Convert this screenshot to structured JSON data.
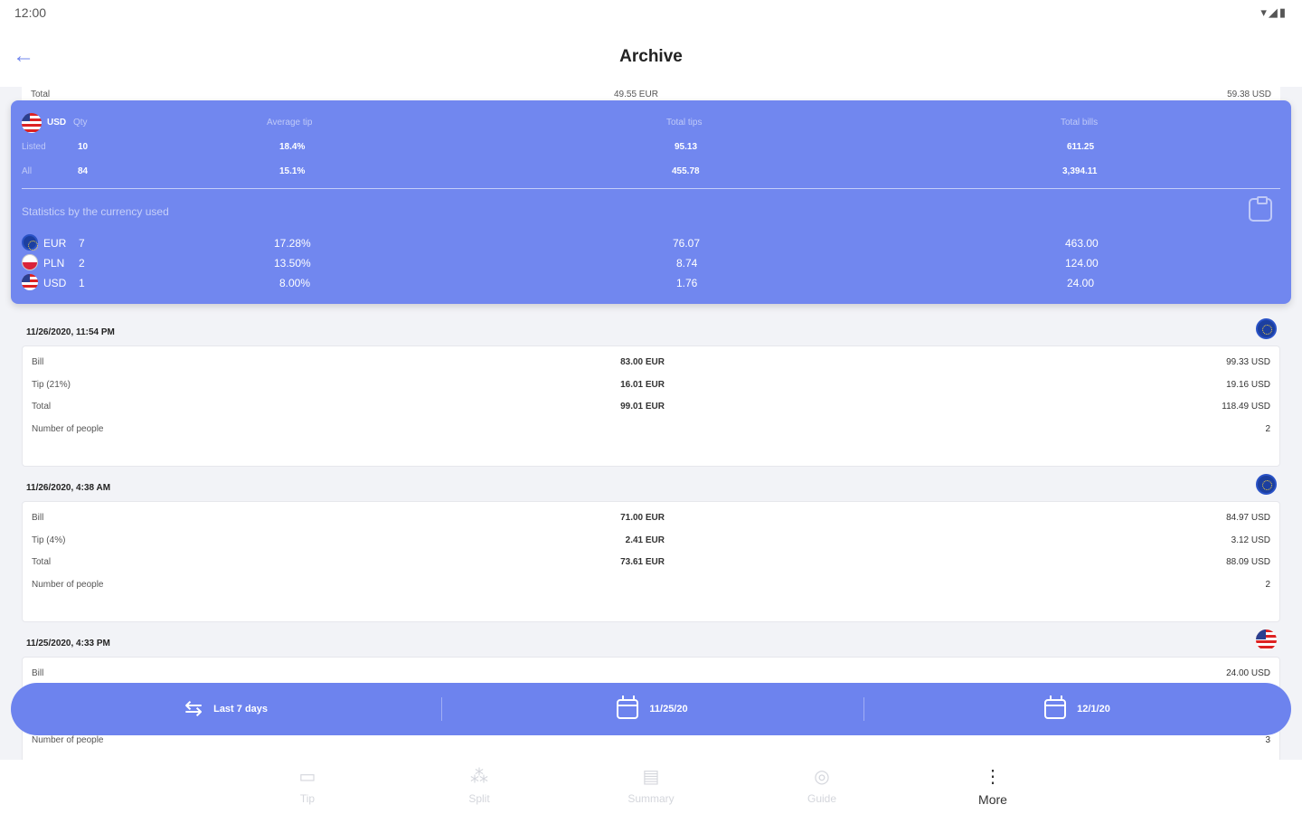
{
  "status_bar": {
    "time": "12:00",
    "icons": "▾◢▮"
  },
  "app_bar": {
    "title": "Archive",
    "back_icon": "arrow-left-icon"
  },
  "previous_entry_total": {
    "label": "Total",
    "mid": "49.55 EUR",
    "right": "59.38 USD"
  },
  "stats": {
    "header": {
      "currency": "USD",
      "qty": "Qty",
      "average_tip": "Average tip",
      "total_tips": "Total tips",
      "total_bills": "Total bills"
    },
    "rows": [
      {
        "label": "Listed",
        "qty": "10",
        "average_tip": "18.4%",
        "total_tips": "95.13",
        "total_bills": "611.25"
      },
      {
        "label": "All",
        "qty": "84",
        "average_tip": "15.1%",
        "total_tips": "455.78",
        "total_bills": "3,394.11"
      }
    ],
    "subtitle": "Statistics by the currency used",
    "by_currency": [
      {
        "currency": "EUR",
        "qty": "7",
        "average_tip": "17.28%",
        "total_tips": "76.07",
        "total_bills": "463.00",
        "flag": "eu"
      },
      {
        "currency": "PLN",
        "qty": "2",
        "average_tip": "13.50%",
        "total_tips": "8.74",
        "total_bills": "124.00",
        "flag": "pl"
      },
      {
        "currency": "USD",
        "qty": "1",
        "average_tip": "8.00%",
        "total_tips": "1.76",
        "total_bills": "24.00",
        "flag": "us"
      }
    ]
  },
  "entries": [
    {
      "date": "11/26/2020, 11:54 PM",
      "flag": "eu",
      "rows": [
        {
          "label": "Bill",
          "mid": "83.00 EUR",
          "right": "99.33 USD"
        },
        {
          "label": "Tip (21%)",
          "mid": "16.01 EUR",
          "right": "19.16 USD"
        },
        {
          "label": "Total",
          "mid": "99.01 EUR",
          "right": "118.49 USD"
        },
        {
          "label": "Number of people",
          "mid": "",
          "right": "2"
        }
      ]
    },
    {
      "date": "11/26/2020, 4:38 AM",
      "flag": "eu",
      "rows": [
        {
          "label": "Bill",
          "mid": "71.00 EUR",
          "right": "84.97 USD"
        },
        {
          "label": "Tip (4%)",
          "mid": "2.41 EUR",
          "right": "3.12 USD"
        },
        {
          "label": "Total",
          "mid": "73.61 EUR",
          "right": "88.09 USD"
        },
        {
          "label": "Number of people",
          "mid": "",
          "right": "2"
        }
      ]
    },
    {
      "date": "11/25/2020, 4:33 PM",
      "flag": "us",
      "rows": [
        {
          "label": "Bill",
          "mid": "",
          "right": "24.00 USD"
        },
        {
          "label": "Number of people",
          "mid": "",
          "right": "3"
        }
      ]
    }
  ],
  "filter_bar": {
    "range": {
      "label": "Last 7 days",
      "icon": "swap-arrows-icon"
    },
    "start_date": {
      "label": "11/25/20",
      "icon": "calendar-icon"
    },
    "end_date": {
      "label": "12/1/20",
      "icon": "calendar-icon"
    }
  },
  "bottom_nav": [
    {
      "label": "Tip",
      "icon": "money-icon"
    },
    {
      "label": "Split",
      "icon": "people-icon"
    },
    {
      "label": "Summary",
      "icon": "receipt-icon"
    },
    {
      "label": "Guide",
      "icon": "compass-icon"
    },
    {
      "label": "More",
      "icon": "more-vertical-icon"
    }
  ]
}
